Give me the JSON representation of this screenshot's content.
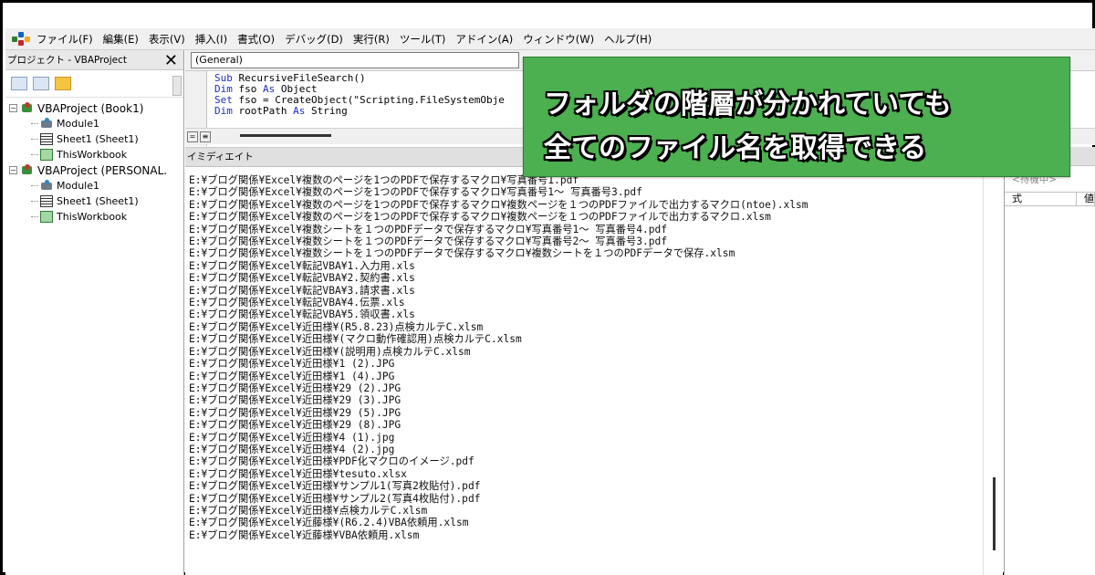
{
  "menubar": {
    "items": [
      "ファイル(F)",
      "編集(E)",
      "表示(V)",
      "挿入(I)",
      "書式(O)",
      "デバッグ(D)",
      "実行(R)",
      "ツール(T)",
      "アドイン(A)",
      "ウィンドウ(W)",
      "ヘルプ(H)"
    ]
  },
  "project_panel": {
    "title": "プロジェクト - VBAProject",
    "close_label": "✕",
    "tree": [
      {
        "label": "VBAProject (Book1)",
        "level": 0,
        "icon": "project-icon"
      },
      {
        "label": "Module1",
        "level": 1,
        "icon": "module-icon"
      },
      {
        "label": "Sheet1 (Sheet1)",
        "level": 1,
        "icon": "sheet-icon"
      },
      {
        "label": "ThisWorkbook",
        "level": 1,
        "icon": "workbook-icon"
      },
      {
        "label": "VBAProject (PERSONAL.",
        "level": 0,
        "icon": "project-icon"
      },
      {
        "label": "Module1",
        "level": 1,
        "icon": "module-icon"
      },
      {
        "label": "Sheet1 (Sheet1)",
        "level": 1,
        "icon": "sheet-icon"
      },
      {
        "label": "ThisWorkbook",
        "level": 1,
        "icon": "workbook-icon"
      }
    ]
  },
  "code_window": {
    "object_combo": "(General)",
    "lines": [
      {
        "kw": "Sub",
        "rest": " RecursiveFileSearch()"
      },
      {
        "kw": "Dim",
        "rest": " fso ",
        "kw2": "As",
        "rest2": " Object"
      },
      {
        "kw": "Set",
        "rest": " fso = CreateObject(\"Scripting.FileSystemObje"
      },
      {
        "kw": "Dim",
        "rest": " rootPath ",
        "kw2": "As",
        "rest2": " String"
      }
    ]
  },
  "immediate": {
    "title": "イミディエイト",
    "lines": [
      "E:¥ブログ関係¥Excel¥複数のページを1つのPDFで保存するマクロ¥写真番号1.pdf",
      "E:¥ブログ関係¥Excel¥複数のページを1つのPDFで保存するマクロ¥写真番号1～ 写真番号3.pdf",
      "E:¥ブログ関係¥Excel¥複数のページを1つのPDFで保存するマクロ¥複数ページを１つのPDFファイルで出力するマクロ(ntoe).xlsm",
      "E:¥ブログ関係¥Excel¥複数のページを1つのPDFで保存するマクロ¥複数ページを１つのPDFファイルで出力するマクロ.xlsm",
      "E:¥ブログ関係¥Excel¥複数シートを１つのPDFデータで保存するマクロ¥写真番号1～ 写真番号4.pdf",
      "E:¥ブログ関係¥Excel¥複数シートを１つのPDFデータで保存するマクロ¥写真番号2～ 写真番号3.pdf",
      "E:¥ブログ関係¥Excel¥複数シートを１つのPDFデータで保存するマクロ¥複数シートを１つのPDFデータで保存.xlsm",
      "E:¥ブログ関係¥Excel¥転記VBA¥1.入力用.xls",
      "E:¥ブログ関係¥Excel¥転記VBA¥2.契約書.xls",
      "E:¥ブログ関係¥Excel¥転記VBA¥3.請求書.xls",
      "E:¥ブログ関係¥Excel¥転記VBA¥4.伝票.xls",
      "E:¥ブログ関係¥Excel¥転記VBA¥5.領収書.xls",
      "E:¥ブログ関係¥Excel¥近田様¥(R5.8.23)点検カルテC.xlsm",
      "E:¥ブログ関係¥Excel¥近田様¥(マクロ動作確認用)点検カルテC.xlsm",
      "E:¥ブログ関係¥Excel¥近田様¥(説明用)点検カルテC.xlsm",
      "E:¥ブログ関係¥Excel¥近田様¥1 (2).JPG",
      "E:¥ブログ関係¥Excel¥近田様¥1 (4).JPG",
      "E:¥ブログ関係¥Excel¥近田様¥29 (2).JPG",
      "E:¥ブログ関係¥Excel¥近田様¥29 (3).JPG",
      "E:¥ブログ関係¥Excel¥近田様¥29 (5).JPG",
      "E:¥ブログ関係¥Excel¥近田様¥29 (8).JPG",
      "E:¥ブログ関係¥Excel¥近田様¥4 (1).jpg",
      "E:¥ブログ関係¥Excel¥近田様¥4 (2).jpg",
      "E:¥ブログ関係¥Excel¥近田様¥PDF化マクロのイメージ.pdf",
      "E:¥ブログ関係¥Excel¥近田様¥tesuto.xlsx",
      "E:¥ブログ関係¥Excel¥近田様¥サンプル1(写真2枚貼付).pdf",
      "E:¥ブログ関係¥Excel¥近田様¥サンプル2(写真4枚貼付).pdf",
      "E:¥ブログ関係¥Excel¥近田様¥点検カルテC.xlsm",
      "E:¥ブログ関係¥Excel¥近藤様¥(R6.2.4)VBA依頼用.xlsm",
      "E:¥ブログ関係¥Excel¥近藤様¥VBA依頼用.xlsm"
    ]
  },
  "watch": {
    "status": "<待機中>",
    "col_expr": "式",
    "col_value": "値"
  },
  "callout": {
    "line1": "フォルダの階層が分かれていても",
    "line2": "全てのファイル名を取得できる",
    "color": "#4caf50"
  }
}
